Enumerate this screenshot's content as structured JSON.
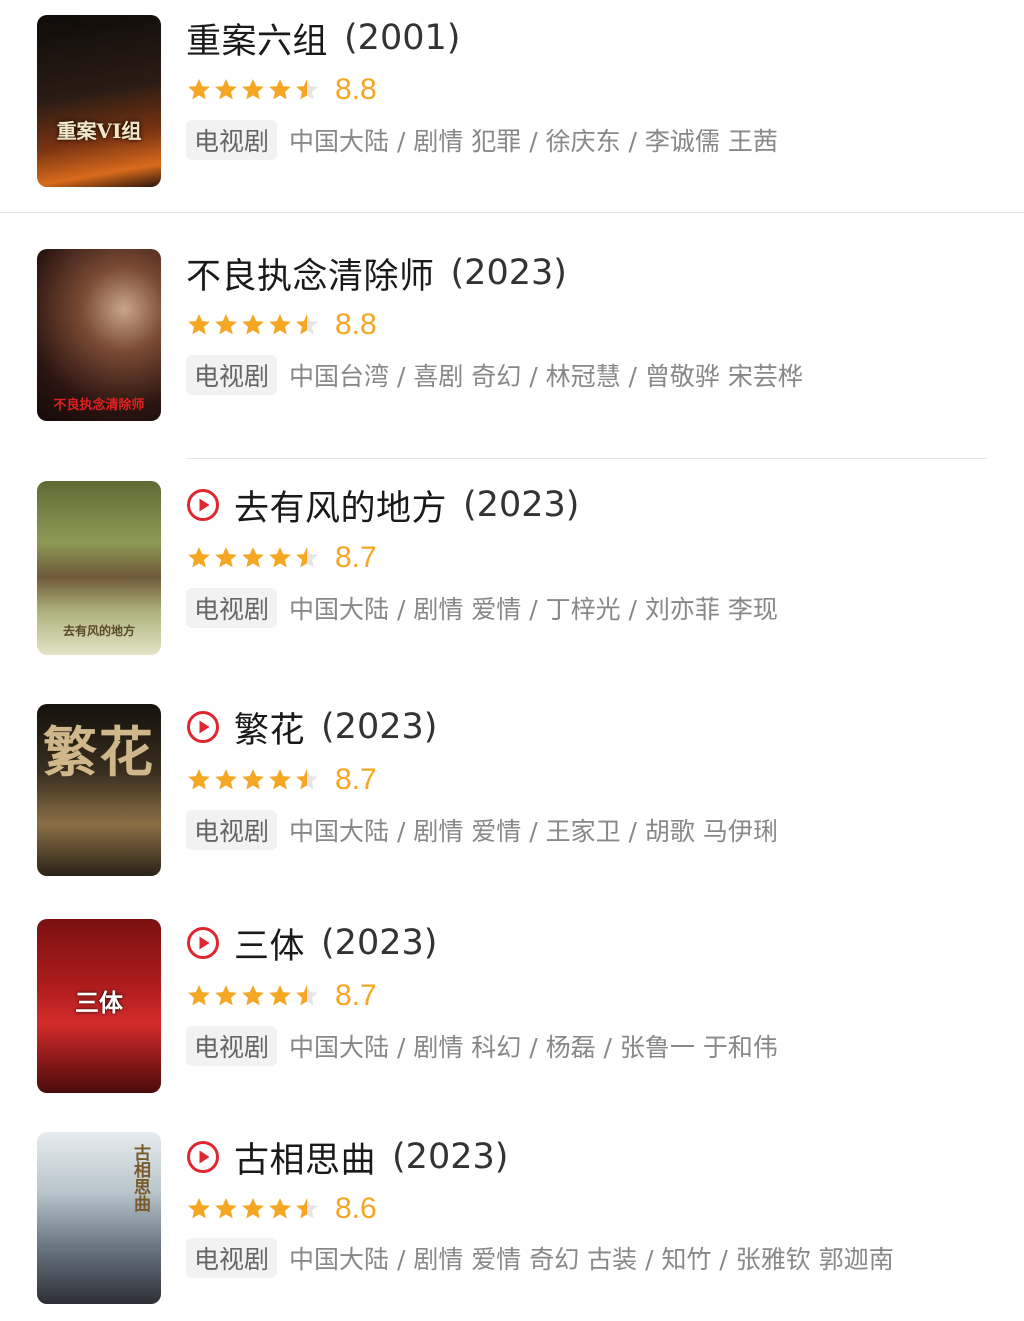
{
  "items": [
    {
      "title": "重案六组",
      "year": "(2001)",
      "score": "8.8",
      "badge": "电视剧",
      "meta": "中国大陆 / 剧情 犯罪 / 徐庆东 / 李诚儒 王茜",
      "has_play": false,
      "poster_text": "重案VI组",
      "poster_colors": [
        "#1b120c",
        "#5a3320",
        "#c7561f"
      ],
      "stars": 4.5
    },
    {
      "title": "不良执念清除师",
      "year": "(2023)",
      "score": "8.8",
      "badge": "电视剧",
      "meta": "中国台湾 / 喜剧 奇幻 / 林冠慧 / 曾敬骅 宋芸桦",
      "has_play": false,
      "poster_text": "不良执念清除师",
      "poster_colors": [
        "#2a1410",
        "#6b3a2a",
        "#a86a4f"
      ],
      "stars": 4.5
    },
    {
      "title": "去有风的地方",
      "year": "(2023)",
      "score": "8.7",
      "badge": "电视剧",
      "meta": "中国大陆 / 剧情 爱情 / 丁梓光 / 刘亦菲 李现",
      "has_play": true,
      "poster_text": "去有风的地方",
      "poster_colors": [
        "#6b7a3a",
        "#a9b06a",
        "#dfe1c2"
      ],
      "stars": 4.5
    },
    {
      "title": "繁花",
      "year": "(2023)",
      "score": "8.7",
      "badge": "电视剧",
      "meta": "中国大陆 / 剧情 爱情 / 王家卫 / 胡歌 马伊琍",
      "has_play": true,
      "poster_text": "繁花",
      "poster_colors": [
        "#1e1a12",
        "#5b4a2e",
        "#b0915e"
      ],
      "stars": 4.5
    },
    {
      "title": "三体",
      "year": "(2023)",
      "score": "8.7",
      "badge": "电视剧",
      "meta": "中国大陆 / 剧情 科幻 / 杨磊 / 张鲁一 于和伟",
      "has_play": true,
      "poster_text": "三体",
      "poster_colors": [
        "#3b0a0a",
        "#9f1b1b",
        "#d12c2c"
      ],
      "stars": 4.5
    },
    {
      "title": "古相思曲",
      "year": "(2023)",
      "score": "8.6",
      "badge": "电视剧",
      "meta": "中国大陆 / 剧情 爱情 奇幻 古装 / 知竹 / 张雅钦 郭迦南",
      "has_play": true,
      "poster_text": "古相思曲",
      "poster_colors": [
        "#dfe6ea",
        "#8a9aa6",
        "#3a3c44"
      ],
      "stars": 4.5
    }
  ],
  "colors": {
    "star": "#f5a623",
    "star_empty": "#e5e5e5",
    "play": "#e0272f"
  }
}
